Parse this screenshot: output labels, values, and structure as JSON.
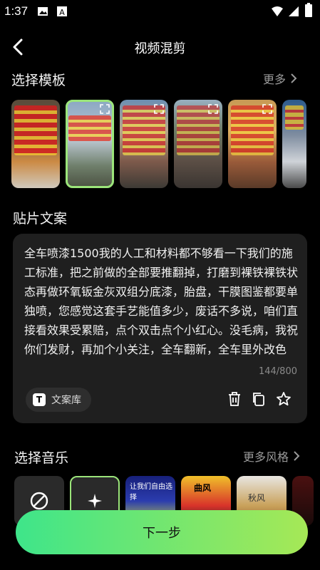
{
  "status_bar": {
    "time": "1:37"
  },
  "header": {
    "title": "视频混剪"
  },
  "templates_section": {
    "title": "选择模板",
    "more_label": "更多"
  },
  "copy_section": {
    "title": "贴片文案",
    "text": "全车喷漆1500我的人工和材料都不够看一下我们的施工标准，把之前做的全部要推翻掉，打磨到裸铁裸铁状态再做环氧钣金灰双组分底漆，胎盘，干膜图鉴都要单独喷，您感觉这套手艺能值多少，废话不多说，咱们直接看效果受累赔，点个双击点个小红心。没毛病，我祝你们发财，再加个小关注，全车翻新，全车里外改色",
    "char_count": "144/800",
    "library_label": "文案库"
  },
  "music_section": {
    "title": "选择音乐",
    "more_label": "更多风格"
  },
  "music_tiles": [
    {
      "icon": "no-music-icon"
    },
    {
      "icon": "sparkle-icon"
    },
    {
      "caption": "让我们自由选择"
    },
    {
      "caption": "曲风"
    },
    {
      "caption": "秋风"
    },
    {
      "caption": ""
    }
  ],
  "next_button": {
    "label": "下一步"
  },
  "colors": {
    "accent_start": "#3ee58a",
    "accent_end": "#a6e856",
    "selected_outline": "#9be57a",
    "card_bg": "#1f1f1f"
  }
}
